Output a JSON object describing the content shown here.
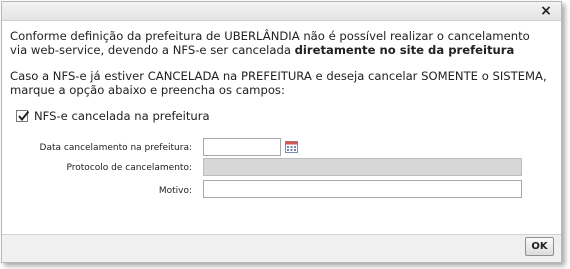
{
  "dialog": {
    "close_glyph": "×",
    "message1": {
      "text": "Conforme definição da prefeitura de UBERLÂNDIA não é possível realizar o cancelamento via web-service, devendo a NFS-e ser cancelada ",
      "bold": "diretamente no site da prefeitura"
    },
    "message2": "Caso a NFS-e já estiver CANCELADA na PREFEITURA e deseja cancelar SOMENTE o SISTEMA, marque a opção abaixo e preencha os campos:",
    "checkbox": {
      "label": "NFS-e cancelada na prefeitura",
      "checked": true
    },
    "fields": {
      "data_label": "Data cancelamento na prefeitura:",
      "data_value": "",
      "protocolo_label": "Protocolo de cancelamento:",
      "protocolo_value": "",
      "motivo_label": "Motivo:",
      "motivo_value": ""
    },
    "ok_label": "OK"
  }
}
